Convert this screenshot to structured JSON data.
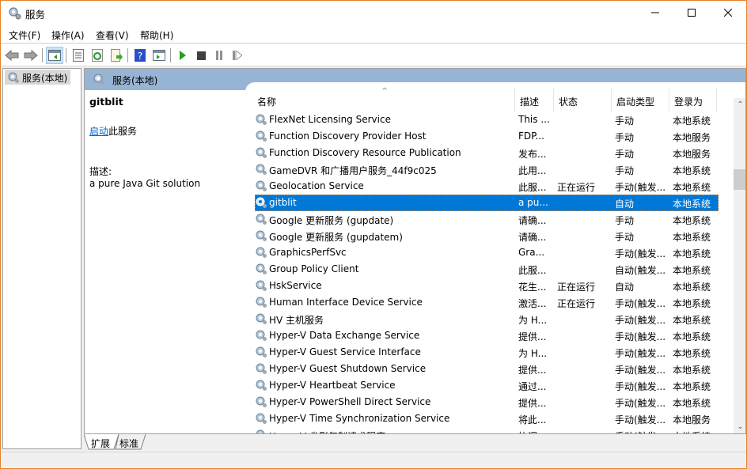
{
  "window": {
    "title": "服务",
    "controls": {
      "minimize": "minimize",
      "maximize": "maximize",
      "close": "close"
    }
  },
  "menu": [
    "文件(F)",
    "操作(A)",
    "查看(V)",
    "帮助(H)"
  ],
  "toolbar": {
    "buttons": [
      "back-arrow-icon",
      "forward-arrow-icon",
      "show-hide-console-tree-icon",
      "properties-icon",
      "refresh-icon",
      "export-list-icon",
      "help-icon",
      "show-hide-action-pane-icon",
      "start-service-icon",
      "stop-service-icon",
      "pause-service-icon",
      "resume-service-icon"
    ]
  },
  "tree": {
    "item": "服务(本地)"
  },
  "main": {
    "header": "服务(本地)",
    "detail": {
      "service_name": "gitblit",
      "action_link": "启动",
      "action_suffix": "此服务",
      "desc_label": "描述:",
      "desc_text": "a pure Java Git solution"
    },
    "columns": [
      "名称",
      "描述",
      "状态",
      "启动类型",
      "登录为"
    ],
    "rows": [
      {
        "name": "FlexNet Licensing Service",
        "desc": "This ...",
        "status": "",
        "startup": "手动",
        "logon": "本地系统"
      },
      {
        "name": "Function Discovery Provider Host",
        "desc": "FDP...",
        "status": "",
        "startup": "手动",
        "logon": "本地服务"
      },
      {
        "name": "Function Discovery Resource Publication",
        "desc": "发布...",
        "status": "",
        "startup": "手动",
        "logon": "本地服务"
      },
      {
        "name": "GameDVR 和广播用户服务_44f9c025",
        "desc": "此用...",
        "status": "",
        "startup": "手动",
        "logon": "本地系统"
      },
      {
        "name": "Geolocation Service",
        "desc": "此服...",
        "status": "正在运行",
        "startup": "手动(触发...",
        "logon": "本地系统"
      },
      {
        "name": "gitblit",
        "desc": "a pu...",
        "status": "",
        "startup": "自动",
        "logon": "本地系统",
        "selected": true
      },
      {
        "name": "Google 更新服务 (gupdate)",
        "desc": "请确...",
        "status": "",
        "startup": "手动",
        "logon": "本地系统"
      },
      {
        "name": "Google 更新服务 (gupdatem)",
        "desc": "请确...",
        "status": "",
        "startup": "手动",
        "logon": "本地系统"
      },
      {
        "name": "GraphicsPerfSvc",
        "desc": "Gra...",
        "status": "",
        "startup": "手动(触发...",
        "logon": "本地系统"
      },
      {
        "name": "Group Policy Client",
        "desc": "此服...",
        "status": "",
        "startup": "自动(触发...",
        "logon": "本地系统"
      },
      {
        "name": "HskService",
        "desc": "花生...",
        "status": "正在运行",
        "startup": "自动",
        "logon": "本地系统"
      },
      {
        "name": "Human Interface Device Service",
        "desc": "激活...",
        "status": "正在运行",
        "startup": "手动(触发...",
        "logon": "本地系统"
      },
      {
        "name": "HV 主机服务",
        "desc": "为 H...",
        "status": "",
        "startup": "手动(触发...",
        "logon": "本地系统"
      },
      {
        "name": "Hyper-V Data Exchange Service",
        "desc": "提供...",
        "status": "",
        "startup": "手动(触发...",
        "logon": "本地系统"
      },
      {
        "name": "Hyper-V Guest Service Interface",
        "desc": "为 H...",
        "status": "",
        "startup": "手动(触发...",
        "logon": "本地系统"
      },
      {
        "name": "Hyper-V Guest Shutdown Service",
        "desc": "提供...",
        "status": "",
        "startup": "手动(触发...",
        "logon": "本地系统"
      },
      {
        "name": "Hyper-V Heartbeat Service",
        "desc": "通过...",
        "status": "",
        "startup": "手动(触发...",
        "logon": "本地系统"
      },
      {
        "name": "Hyper-V PowerShell Direct Service",
        "desc": "提供...",
        "status": "",
        "startup": "手动(触发...",
        "logon": "本地系统"
      },
      {
        "name": "Hyper-V Time Synchronization Service",
        "desc": "将此...",
        "status": "",
        "startup": "手动(触发...",
        "logon": "本地服务"
      },
      {
        "name": "Hyper-V 卷影复制请求程序",
        "desc": "协调...",
        "status": "",
        "startup": "手动(触发...",
        "logon": "本地系统"
      }
    ]
  },
  "tabs": [
    "扩展",
    "标准"
  ],
  "colors": {
    "selection": "#0078d7",
    "header_band": "#98b4d4",
    "window_border": "#e6822a",
    "link": "#0066cc"
  }
}
